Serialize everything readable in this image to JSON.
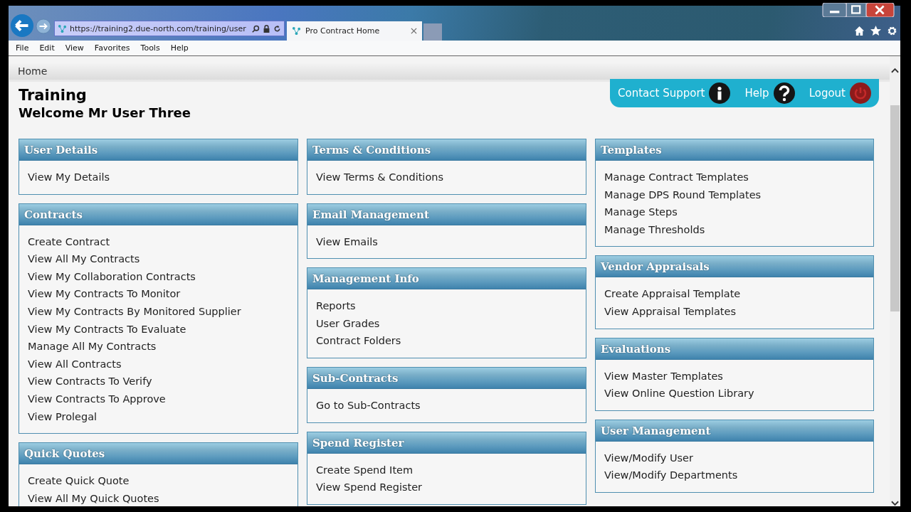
{
  "browser": {
    "url": "https://training2.due-north.com/training/user",
    "tab_title": "Pro Contract Home",
    "menu": [
      "File",
      "Edit",
      "View",
      "Favorites",
      "Tools",
      "Help"
    ]
  },
  "breadcrumb": "Home",
  "header": {
    "title": "Training",
    "welcome": "Welcome Mr User Three"
  },
  "actions": [
    {
      "label": "Contact Support",
      "kind": "info"
    },
    {
      "label": "Help",
      "kind": "help"
    },
    {
      "label": "Logout",
      "kind": "logout"
    }
  ],
  "columns": [
    [
      {
        "title": "User Details",
        "links": [
          "View My Details"
        ]
      },
      {
        "title": "Contracts",
        "links": [
          "Create Contract",
          "View All My Contracts",
          "View My Collaboration Contracts",
          "View My Contracts To Monitor",
          "View My Contracts By Monitored Supplier",
          "View My Contracts To Evaluate",
          "Manage All My Contracts",
          "View All Contracts",
          "View Contracts To Verify",
          "View Contracts To Approve",
          "View Prolegal"
        ]
      },
      {
        "title": "Quick Quotes",
        "links": [
          "Create Quick Quote",
          "View All My Quick Quotes"
        ]
      }
    ],
    [
      {
        "title": "Terms & Conditions",
        "links": [
          "View Terms & Conditions"
        ]
      },
      {
        "title": "Email Management",
        "links": [
          "View Emails"
        ]
      },
      {
        "title": "Management Info",
        "links": [
          "Reports",
          "User Grades",
          "Contract Folders"
        ]
      },
      {
        "title": "Sub-Contracts",
        "links": [
          "Go to Sub-Contracts"
        ]
      },
      {
        "title": "Spend Register",
        "links": [
          "Create Spend Item",
          "View Spend Register"
        ]
      }
    ],
    [
      {
        "title": "Templates",
        "links": [
          "Manage Contract Templates",
          "Manage DPS Round Templates",
          "Manage Steps",
          "Manage Thresholds"
        ]
      },
      {
        "title": "Vendor Appraisals",
        "links": [
          "Create Appraisal Template",
          "View Appraisal Templates"
        ]
      },
      {
        "title": "Evaluations",
        "links": [
          "View Master Templates",
          "View Online Question Library"
        ]
      },
      {
        "title": "User Management",
        "links": [
          "View/Modify User",
          "View/Modify Departments"
        ]
      }
    ]
  ]
}
